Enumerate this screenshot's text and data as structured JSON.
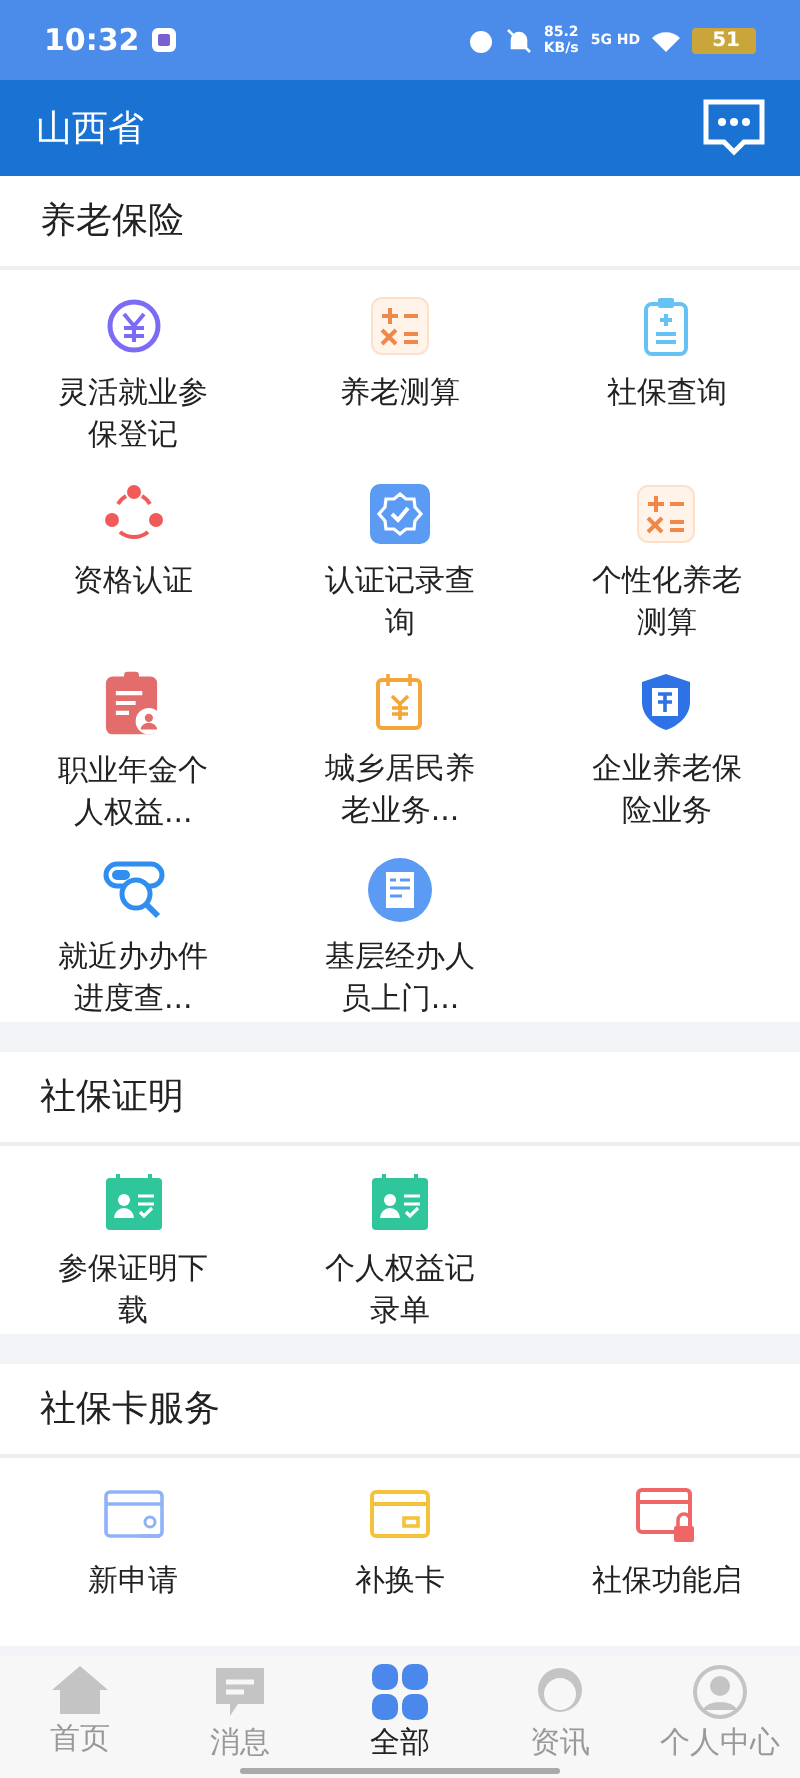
{
  "status_bar": {
    "time": "10:32",
    "speed": "85.2",
    "speed_unit": "KB/s",
    "network": "5G HD",
    "battery": "51"
  },
  "header": {
    "title": "山西省"
  },
  "sections": [
    {
      "title": "养老保险",
      "items": [
        {
          "label": "灵活就业参保登记"
        },
        {
          "label": "养老测算"
        },
        {
          "label": "社保查询"
        },
        {
          "label": "资格认证"
        },
        {
          "label": "认证记录查询"
        },
        {
          "label": "个性化养老测算"
        },
        {
          "label": "职业年金个人权益..."
        },
        {
          "label": "城乡居民养老业务..."
        },
        {
          "label": "企业养老保险业务"
        },
        {
          "label": "就近办办件进度查..."
        },
        {
          "label": "基层经办人员上门..."
        }
      ]
    },
    {
      "title": "社保证明",
      "items": [
        {
          "label": "参保证明下载"
        },
        {
          "label": "个人权益记录单"
        }
      ]
    },
    {
      "title": "社保卡服务",
      "items": [
        {
          "label": "新申请"
        },
        {
          "label": "补换卡"
        },
        {
          "label": "社保功能启"
        }
      ]
    }
  ],
  "tab_bar": [
    {
      "label": "首页",
      "selected": false
    },
    {
      "label": "消息",
      "selected": false
    },
    {
      "label": "全部",
      "selected": true
    },
    {
      "label": "资讯",
      "selected": false
    },
    {
      "label": "个人中心",
      "selected": false
    }
  ]
}
